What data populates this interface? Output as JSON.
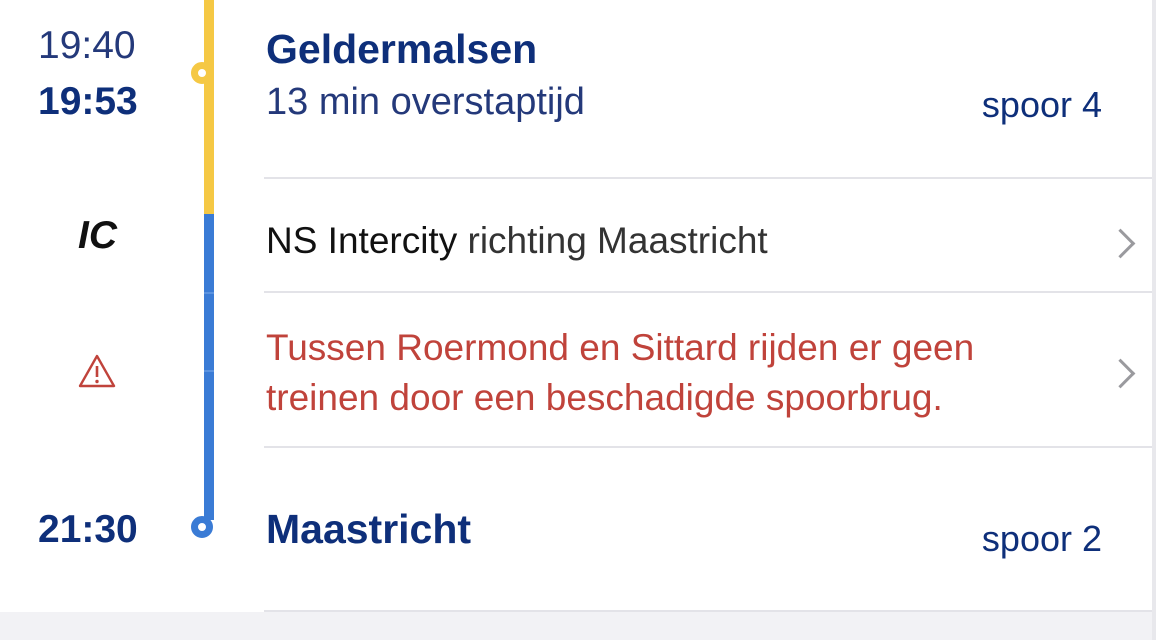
{
  "departure": {
    "arrival_time": "19:40",
    "departure_time": "19:53",
    "station": "Geldermalsen",
    "transfer": "13 min overstaptijd",
    "platform": "spoor 4"
  },
  "train": {
    "type_badge": "IC",
    "operator": "NS Intercity",
    "direction": "richting Maastricht"
  },
  "disruption": {
    "icon": "warning-triangle-icon",
    "message": "Tussen Roermond en Sittard rijden er geen treinen door een beschadigde spoorbrug."
  },
  "arrival": {
    "time": "21:30",
    "station": "Maastricht",
    "platform": "spoor 2"
  },
  "colors": {
    "accent_blue": "#0e2f7a",
    "line_yellow": "#f5c844",
    "line_blue": "#3a7bd5",
    "warning_red": "#c0433b"
  }
}
